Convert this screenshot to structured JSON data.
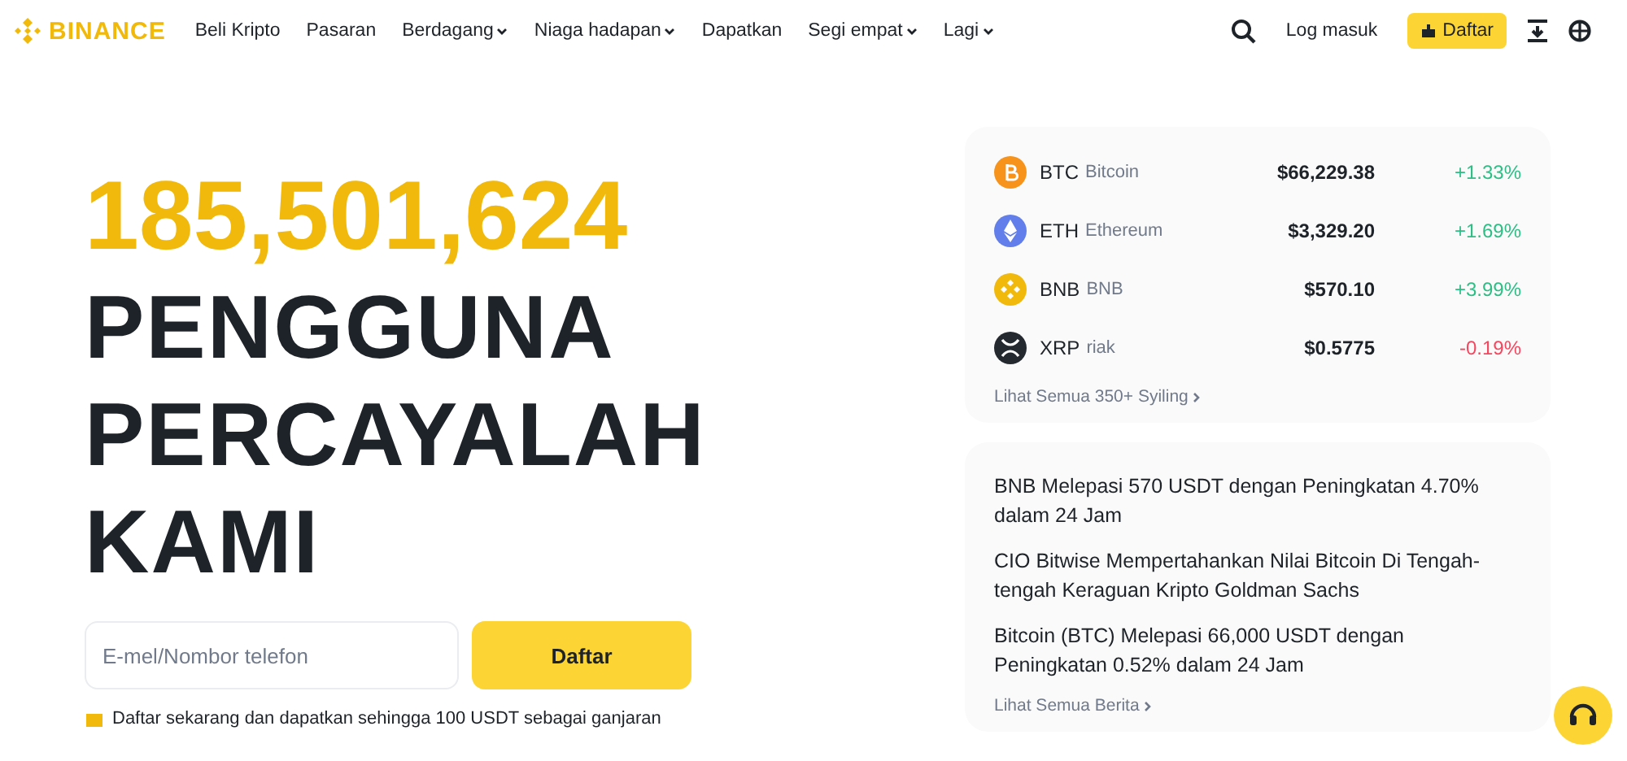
{
  "brand": "BINANCE",
  "nav": [
    {
      "label": "Beli Kripto",
      "dropdown": false
    },
    {
      "label": "Pasaran",
      "dropdown": false
    },
    {
      "label": "Berdagang",
      "dropdown": true
    },
    {
      "label": "Niaga hadapan",
      "dropdown": true
    },
    {
      "label": "Dapatkan",
      "dropdown": false
    },
    {
      "label": "Segi empat",
      "dropdown": true
    },
    {
      "label": "Lagi",
      "dropdown": true
    }
  ],
  "login": "Log masuk",
  "signup": "Daftar",
  "hero": {
    "count": "185,501,624",
    "lines": [
      "PENGGUNA",
      "PERCAYALAH",
      "KAMI"
    ]
  },
  "signup_form": {
    "placeholder": "E-mel/Nombor telefon",
    "button": "Daftar",
    "promo": "Daftar sekarang dan dapatkan sehingga 100 USDT sebagai ganjaran"
  },
  "coins": [
    {
      "kind": "btc",
      "symbol": "BTC",
      "name": "Bitcoin",
      "price": "$66,229.38",
      "change": "+1.33%",
      "color": "#2ebd85"
    },
    {
      "kind": "eth",
      "symbol": "ETH",
      "name": "Ethereum",
      "price": "$3,329.20",
      "change": "+1.69%",
      "color": "#2ebd85"
    },
    {
      "kind": "bnb",
      "symbol": "BNB",
      "name": "BNB",
      "price": "$570.10",
      "change": "+3.99%",
      "color": "#2ebd85"
    },
    {
      "kind": "xrp",
      "symbol": "XRP",
      "name": "riak",
      "price": "$0.5775",
      "change": "-0.19%",
      "color": "#f6465d"
    }
  ],
  "coins_link": "Lihat Semua 350+ Syiling",
  "news": [
    "BNB Melepasi 570 USDT dengan Peningkatan 4.70% dalam 24 Jam",
    "CIO Bitwise Mempertahankan Nilai Bitcoin Di Tengah-tengah Keraguan Kripto Goldman Sachs",
    "Bitcoin (BTC) Melepasi 66,000 USDT dengan Peningkatan 0.52% dalam 24 Jam"
  ],
  "news_link": "Lihat Semua Berita"
}
